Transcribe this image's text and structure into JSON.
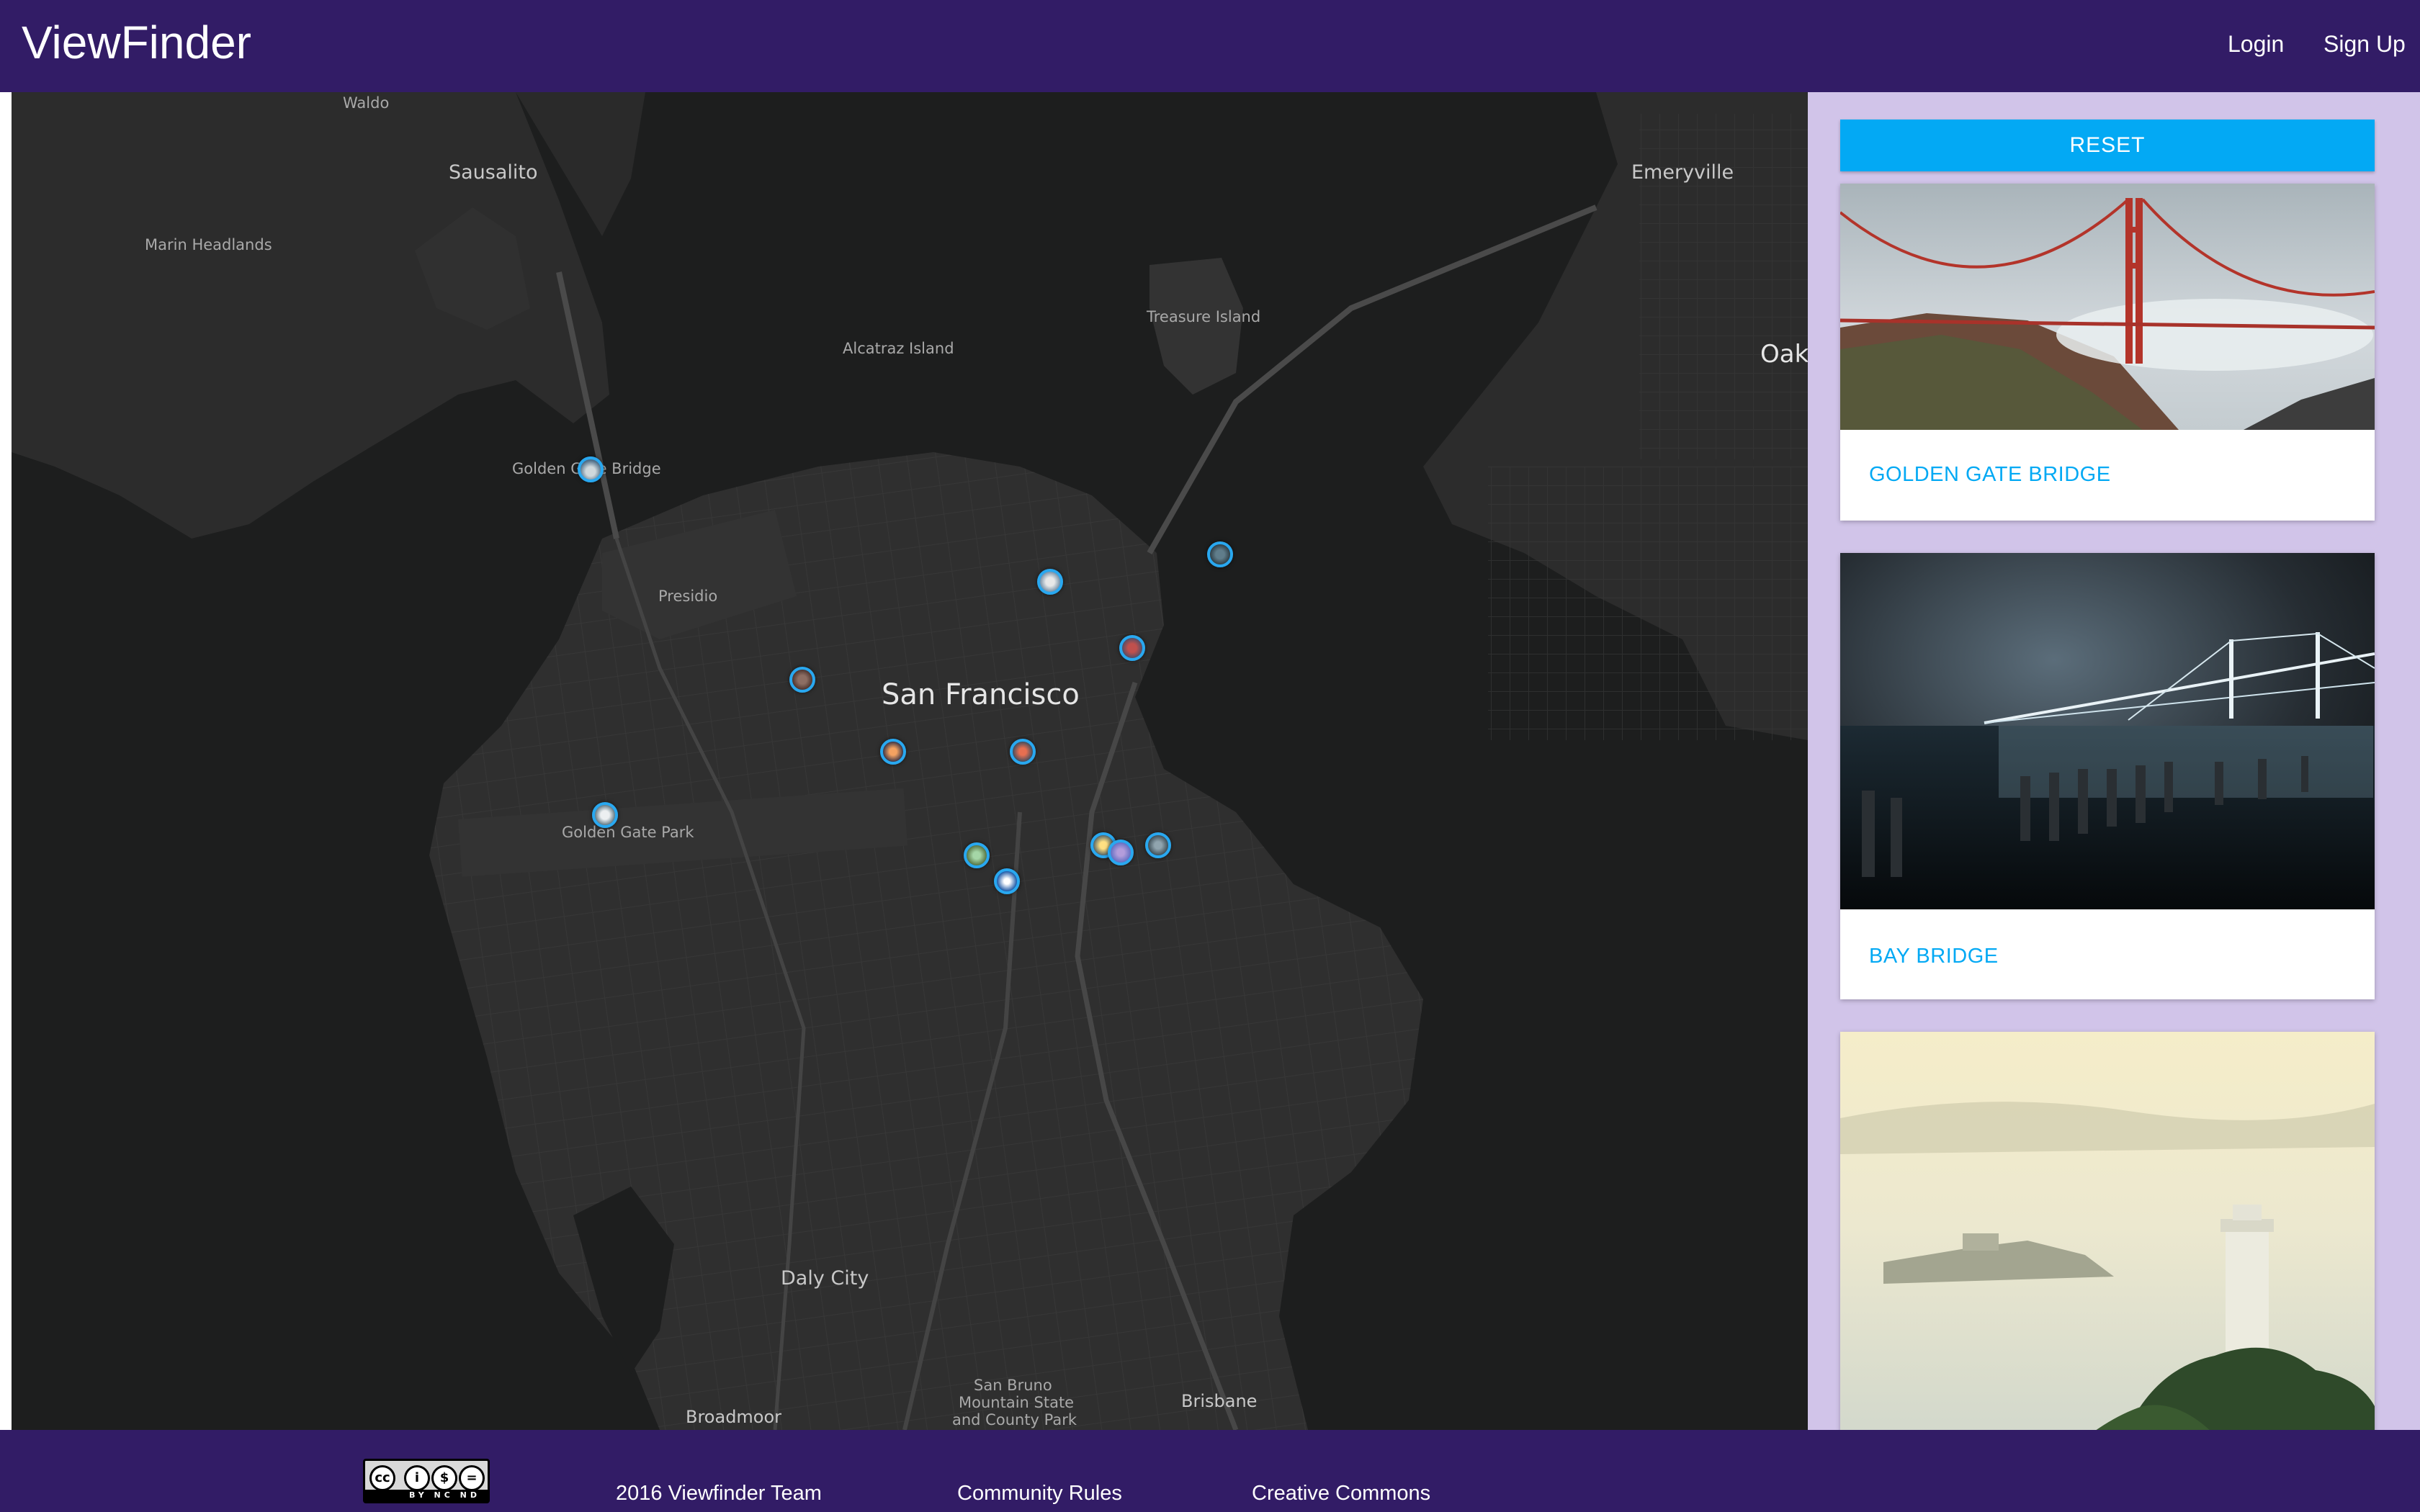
{
  "header": {
    "brand": "ViewFinder",
    "login_label": "Login",
    "signup_label": "Sign Up"
  },
  "map": {
    "labels": {
      "waldo": "Waldo",
      "sausalito": "Sausalito",
      "marin_headlands": "Marin Headlands",
      "alcatraz": "Alcatraz Island",
      "treasure_island": "Treasure Island",
      "emeryville": "Emeryville",
      "oakland": "Oak",
      "golden_gate_bridge": "Golden Gate Bridge",
      "presidio": "Presidio",
      "san_francisco": "San Francisco",
      "golden_gate_park": "Golden Gate Park",
      "daly_city": "Daly City",
      "san_bruno_line1": "San Bruno",
      "san_bruno_line2": "Mountain State",
      "san_bruno_line3": "and County Park",
      "brisbane": "Brisbane",
      "broadmoor": "Broadmoor"
    },
    "marker_count": 13
  },
  "sidebar": {
    "reset_label": "RESET",
    "cards": [
      {
        "title": "GOLDEN GATE BRIDGE"
      },
      {
        "title": "BAY BRIDGE"
      },
      {
        "title": ""
      }
    ]
  },
  "footer": {
    "cc_badge_text": "BY NC ND",
    "team": "2016 Viewfinder Team",
    "community_rules": "Community Rules",
    "creative_commons": "Creative Commons"
  },
  "colors": {
    "header_bg": "#321c66",
    "sidebar_bg": "#d1c4e9",
    "accent": "#03a9f4",
    "map_water": "#1d1e1e",
    "map_land": "#2e2e2e"
  }
}
